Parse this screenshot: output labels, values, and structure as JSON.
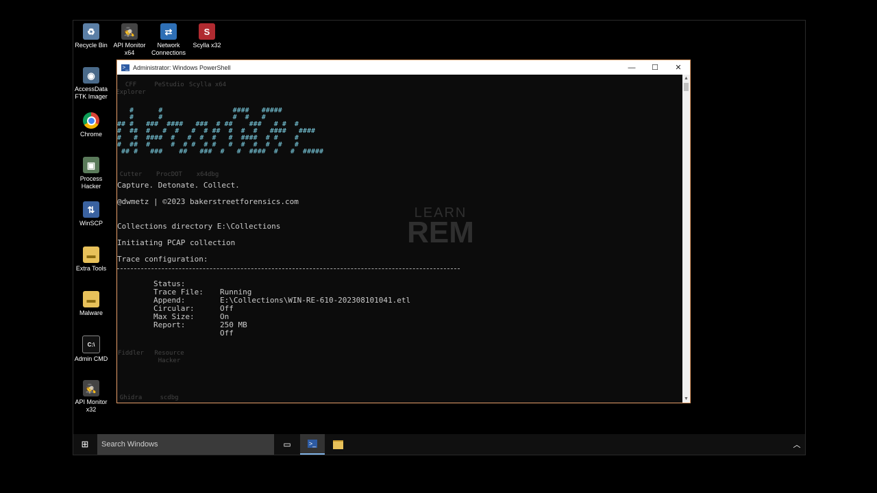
{
  "desktop_icons": [
    {
      "label": "Recycle Bin",
      "icon": "recycle-bin-icon"
    },
    {
      "label": "API Monitor x64",
      "icon": "api-monitor-icon"
    },
    {
      "label": "Network Connections",
      "icon": "network-connections-icon"
    },
    {
      "label": "Scylla x32",
      "icon": "scylla-icon"
    },
    {
      "label": "AccessData FTK Imager",
      "icon": "ftk-imager-icon"
    },
    {
      "label": "Chrome",
      "icon": "chrome-icon"
    },
    {
      "label": "Process Hacker",
      "icon": "process-hacker-icon"
    },
    {
      "label": "WinSCP",
      "icon": "winscp-icon"
    },
    {
      "label": "Extra Tools",
      "icon": "folder-icon"
    },
    {
      "label": "Malware",
      "icon": "folder-icon"
    },
    {
      "label": "Admin CMD",
      "icon": "cmd-icon"
    },
    {
      "label": "API Monitor x32",
      "icon": "api-monitor-icon"
    }
  ],
  "background_icons": [
    {
      "label": "CFF Explorer"
    },
    {
      "label": "PeStudio"
    },
    {
      "label": "Scylla x64"
    },
    {
      "label": "Cutter"
    },
    {
      "label": "ProcDOT"
    },
    {
      "label": "x64dbg"
    },
    {
      "label": "Fiddler"
    },
    {
      "label": "Resource Hacker"
    },
    {
      "label": "Ghidra"
    },
    {
      "label": "scdbg"
    }
  ],
  "window": {
    "title": "Administrator: Windows PowerShell",
    "minimize": "—",
    "maximize": "☐",
    "close": "✕"
  },
  "console": {
    "banner": "   #      #                 ####   #####\n   #      #                 #  #   #\n## #   ###  ####   ###  # ##    ###   # #  #\n#  ##  #   #  #   #  # ##  #  #  #   ####   ####\n#   #  ####  #   #  #  #   #  ####  # #    #\n#  ##  #     #  # #  # #   #  #  #  #  #   #\n ## #   ###    ##   ###  #   #  ####  #   #  #####",
    "tagline": "Capture. Detonate. Collect.",
    "credit": "@dwmetz | ©2023 bakerstreetforensics.com",
    "collections_line": "Collections directory E:\\Collections",
    "pcap_line": "Initiating PCAP collection",
    "trace_header": "Trace configuration:",
    "trace_rows": [
      {
        "label": "Status:",
        "value": "Running"
      },
      {
        "label": "Trace File:",
        "value": "E:\\Collections\\WIN-RE-610-202308101041.etl"
      },
      {
        "label": "Append:",
        "value": "Off"
      },
      {
        "label": "Circular:",
        "value": "On"
      },
      {
        "label": "Max Size:",
        "value": "250 MB"
      },
      {
        "label": "Report:",
        "value": "Off"
      }
    ]
  },
  "watermark": {
    "line1": "LEARN",
    "line2": "REM"
  },
  "taskbar": {
    "search_placeholder": "Search Windows",
    "start_icon": "windows-logo-icon",
    "accent": "#7fb2e5"
  }
}
